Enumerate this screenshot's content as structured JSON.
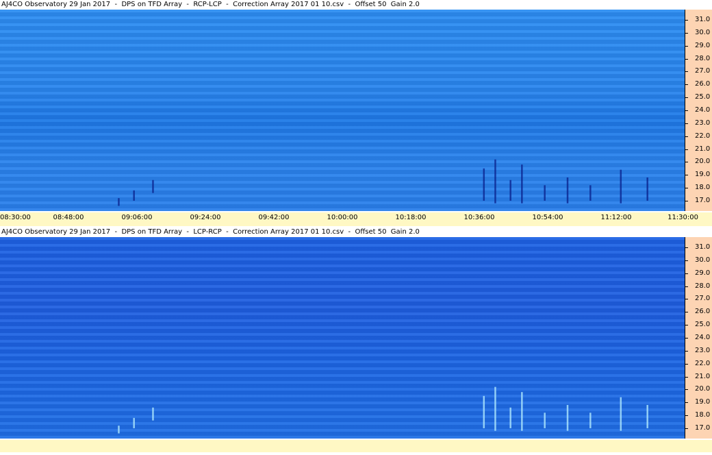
{
  "panels": [
    {
      "title": "AJ4CO Observatory 29 Jan 2017  -  DPS on TFD Array  -  RCP-LCP  -  Correction Array 2017 01 10.csv  -  Offset 50  Gain 2.0",
      "polarization": "RCP-LCP",
      "colors": {
        "base": "#2a86ee",
        "burst": "#0a1f8a"
      },
      "y_ticks": [
        "31.0",
        "30.0",
        "29.0",
        "28.0",
        "27.0",
        "26.0",
        "25.0",
        "24.0",
        "23.0",
        "22.0",
        "21.0",
        "20.0",
        "19.0",
        "18.0",
        "17.0"
      ],
      "x_ticks": [
        "08:30:00",
        "08:48:00",
        "09:06:00",
        "09:24:00",
        "09:42:00",
        "10:00:00",
        "10:18:00",
        "10:36:00",
        "10:54:00",
        "11:12:00",
        "11:30:00"
      ]
    },
    {
      "title": "AJ4CO Observatory 29 Jan 2017  -  DPS on TFD Array  -  LCP-RCP  -  Correction Array 2017 01 10.csv  -  Offset 50  Gain 2.0",
      "polarization": "LCP-RCP",
      "colors": {
        "base": "#1f62e2",
        "burst": "#b8f0ff"
      },
      "y_ticks": [
        "31.0",
        "30.0",
        "29.0",
        "28.0",
        "27.0",
        "26.0",
        "25.0",
        "24.0",
        "23.0",
        "22.0",
        "21.0",
        "20.0",
        "19.0",
        "18.0",
        "17.0"
      ]
    }
  ],
  "axis": {
    "y_unit_range": [
      16.2,
      31.8
    ],
    "x_range": [
      "08:30:00",
      "11:30:00"
    ]
  },
  "bursts": [
    {
      "time_min": 31,
      "freq_lo": 16.6,
      "freq_hi": 17.2
    },
    {
      "time_min": 35,
      "freq_lo": 17.0,
      "freq_hi": 17.8
    },
    {
      "time_min": 40,
      "freq_lo": 17.6,
      "freq_hi": 18.6
    },
    {
      "time_min": 127,
      "freq_lo": 17.0,
      "freq_hi": 19.5
    },
    {
      "time_min": 130,
      "freq_lo": 16.8,
      "freq_hi": 20.2
    },
    {
      "time_min": 134,
      "freq_lo": 17.0,
      "freq_hi": 18.6
    },
    {
      "time_min": 137,
      "freq_lo": 16.8,
      "freq_hi": 19.8
    },
    {
      "time_min": 143,
      "freq_lo": 17.0,
      "freq_hi": 18.2
    },
    {
      "time_min": 149,
      "freq_lo": 16.8,
      "freq_hi": 18.8
    },
    {
      "time_min": 155,
      "freq_lo": 17.0,
      "freq_hi": 18.2
    },
    {
      "time_min": 163,
      "freq_lo": 16.8,
      "freq_hi": 19.4
    },
    {
      "time_min": 170,
      "freq_lo": 17.0,
      "freq_hi": 18.8
    }
  ]
}
